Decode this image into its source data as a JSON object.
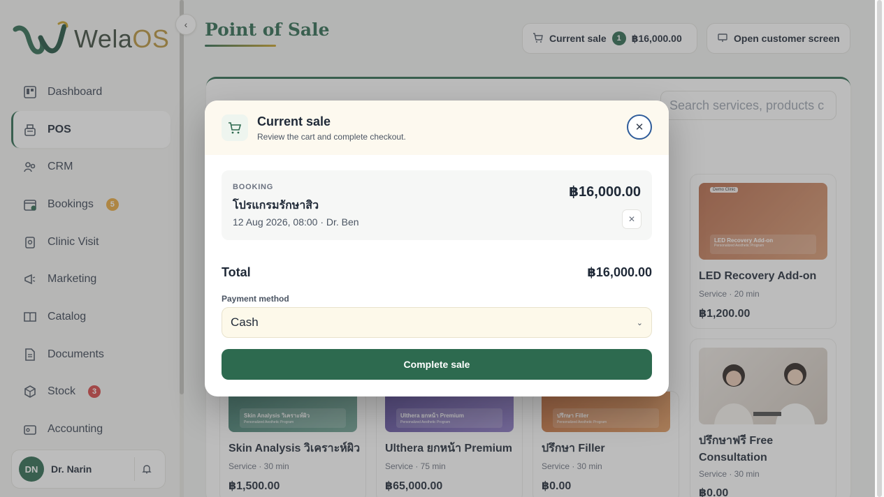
{
  "brand": {
    "name_main": "Wela",
    "name_accent": "OS"
  },
  "colors": {
    "primary": "#2d6a4f",
    "accent": "#c9a227",
    "badge_orange": "#e9a93c",
    "badge_red": "#d64545"
  },
  "sidebar": {
    "items": [
      {
        "label": "Dashboard",
        "icon": "dashboard-icon"
      },
      {
        "label": "POS",
        "icon": "register-icon",
        "active": true
      },
      {
        "label": "CRM",
        "icon": "users-icon"
      },
      {
        "label": "Bookings",
        "icon": "calendar-icon",
        "badge": "5"
      },
      {
        "label": "Clinic Visit",
        "icon": "clipboard-icon"
      },
      {
        "label": "Marketing",
        "icon": "megaphone-icon"
      },
      {
        "label": "Catalog",
        "icon": "book-icon"
      },
      {
        "label": "Documents",
        "icon": "document-icon"
      },
      {
        "label": "Stock",
        "icon": "box-icon",
        "badge": "3"
      },
      {
        "label": "Accounting",
        "icon": "wallet-icon"
      }
    ],
    "user": {
      "initials": "DN",
      "name": "Dr. Narin"
    }
  },
  "header": {
    "title": "Point of Sale",
    "current_sale_label": "Current sale",
    "current_sale_count": "1",
    "current_sale_total": "฿16,000.00",
    "customer_screen_label": "Open customer screen"
  },
  "search": {
    "placeholder": "Search services, products c"
  },
  "products": [
    {
      "title": "LED Recovery Add-on",
      "meta": "Service · 20 min",
      "price": "฿1,200.00",
      "thumb_label": "LED Recovery Add-on",
      "thumb_sub": "Personalized Aesthetic Program",
      "tag": "Demo Clinic"
    },
    {
      "title": "Skin Analysis วิเคราะห์ผิว",
      "meta": "Service · 30 min",
      "price": "฿1,500.00",
      "thumb_label": "Skin Analysis วิเคราะห์ผิว",
      "thumb_sub": "Personalized Aesthetic Program"
    },
    {
      "title": "Ulthera ยกหน้า Premium",
      "meta": "Service · 75 min",
      "price": "฿65,000.00",
      "thumb_label": "Ulthera ยกหน้า Premium",
      "thumb_sub": "Personalized Aesthetic Program"
    },
    {
      "title": "ปรึกษา Filler",
      "meta": "Service · 30 min",
      "price": "฿0.00",
      "thumb_label": "ปรึกษา Filler",
      "thumb_sub": "Personalized Aesthetic Program"
    },
    {
      "title_line1": "ปรึกษาฟรี Free",
      "title_line2": "Consultation",
      "meta": "Service · 30 min",
      "price": "฿0.00"
    }
  ],
  "modal": {
    "title": "Current sale",
    "subtitle": "Review the cart and complete checkout.",
    "line_item": {
      "kind": "BOOKING",
      "name": "โปรแกรมรักษาสิว",
      "date": "12 Aug 2026, 08:00 · Dr. Ben",
      "price": "฿16,000.00"
    },
    "total_label": "Total",
    "total_value": "฿16,000.00",
    "payment_label": "Payment method",
    "payment_value": "Cash",
    "complete_label": "Complete sale"
  }
}
